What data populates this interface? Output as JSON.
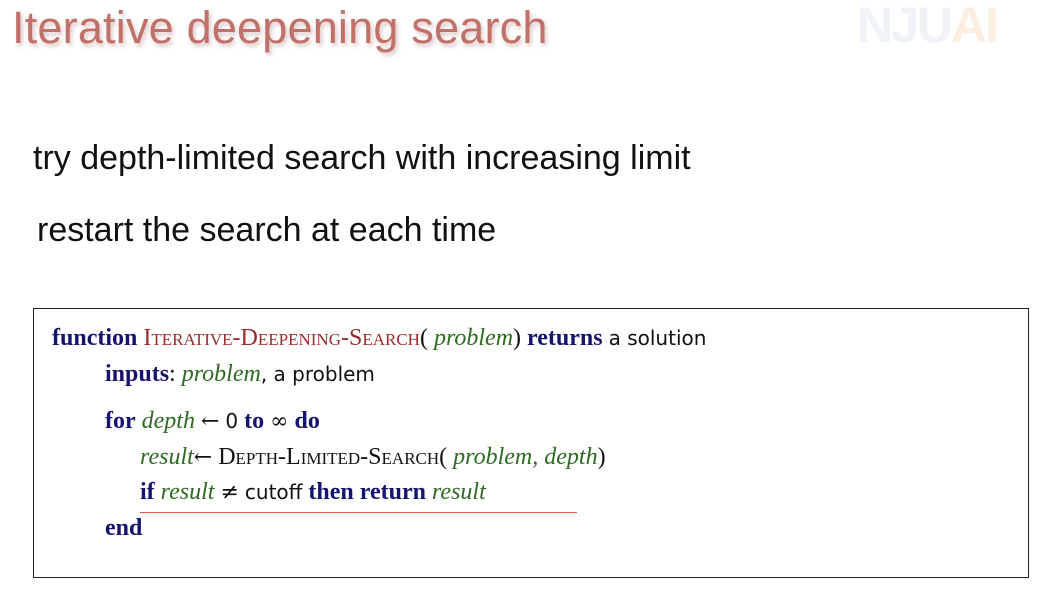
{
  "slide": {
    "title": "Iterative deepening search",
    "logo": {
      "nj": "NJU",
      "ai": "AI"
    },
    "bullets": [
      "try depth-limited search with increasing limit",
      "restart the search at each time"
    ]
  },
  "algorithm": {
    "line1": {
      "kw_function": "function",
      "name": "Iterative-Deepening-Search",
      "open": "(",
      "param": "problem",
      "close": ")",
      "kw_returns": "returns",
      "tail": "a solution"
    },
    "line2": {
      "kw_inputs": "inputs",
      "colon": ":",
      "param": "problem",
      "tail": ", a problem"
    },
    "line3": {
      "kw_for": "for",
      "var": "depth",
      "arrow": "←",
      "start": "0",
      "kw_to": "to",
      "infinity": "∞",
      "kw_do": "do"
    },
    "line4": {
      "var": "result",
      "arrow": "←",
      "call": "Depth-Limited-Search",
      "open": "(",
      "args": "problem, depth",
      "close": ")"
    },
    "line5": {
      "kw_if": "if",
      "var": "result",
      "neq": "≠",
      "cutoff": "cutoff",
      "kw_then_return": "then return",
      "var2": "result"
    },
    "line6": {
      "kw_end": "end"
    }
  },
  "colors": {
    "title": "#c0716a",
    "keyword": "#14146e",
    "function_name": "#9b2a2a",
    "variable": "#2e6a22",
    "underline": "#e35a4f"
  }
}
